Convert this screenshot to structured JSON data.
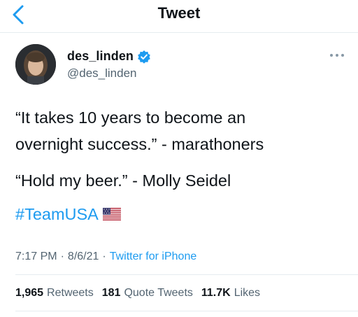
{
  "nav": {
    "title": "Tweet",
    "back_icon": "chevron-left-icon"
  },
  "author": {
    "display_name": "des_linden",
    "handle": "@des_linden",
    "verified": true
  },
  "tweet": {
    "lines": [
      "“It takes 10 years to become an",
      "overnight success.” - marathoners",
      "“Hold my beer.” - Molly Seidel"
    ],
    "hashtag": "#TeamUSA",
    "emoji": "us-flag-icon"
  },
  "meta": {
    "time": "7:17 PM",
    "separator1": "·",
    "date": "8/6/21",
    "separator2": "·",
    "source": "Twitter for iPhone"
  },
  "stats": {
    "retweets_count": "1,965",
    "retweets_label": "Retweets",
    "quotes_count": "181",
    "quotes_label": "Quote Tweets",
    "likes_count": "11.7K",
    "likes_label": "Likes"
  },
  "colors": {
    "accent": "#1d9bf0",
    "text": "#0f1419",
    "secondary": "#536471",
    "divider": "#e6ecf0"
  }
}
